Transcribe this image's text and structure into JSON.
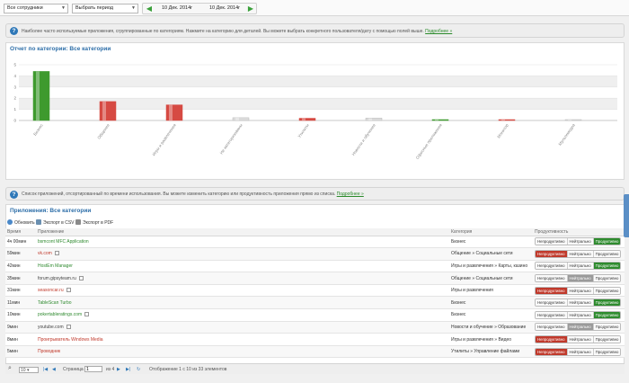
{
  "toolbar": {
    "employee_select": "Все сотрудники",
    "period_select": "Выбрать период",
    "date_from": "10 Дек. 2014г",
    "date_to": "10 Дек. 2014г"
  },
  "info_top": {
    "text": "Наиболее часто используемые приложения, сгруппированные по категориям. Нажмите на категорию для деталей. Вы можете выбрать конкретного пользователя/дату с помощью полей выше.",
    "link": "Подробнее »"
  },
  "chart_panel": {
    "title": "Отчет по категории:  Все категории"
  },
  "chart_data": {
    "type": "bar",
    "title": "",
    "xlabel": "",
    "ylabel": "",
    "ylim": [
      0,
      5
    ],
    "yticks": [
      "0",
      "1",
      "2",
      "3",
      "4",
      "5"
    ],
    "categories": [
      "Бизнес",
      "Общение",
      "Игры и развлечения",
      "Не категоризованы",
      "Утилиты",
      "Новости и обучение",
      "Офисные приложения",
      "Монитор",
      "Мультимедиа"
    ],
    "values": [
      4.4,
      1.7,
      1.4,
      0.25,
      0.2,
      0.22,
      0.08,
      0.05,
      0.03
    ],
    "bar_colors": [
      "#3e9a2e",
      "#d64a43",
      "#d64a43",
      "#dddddd",
      "#d64a43",
      "#dddddd",
      "#3e9a2e",
      "#d64a43",
      "#dddddd"
    ],
    "grid": true
  },
  "info_apps": {
    "text": "Список приложений, отсортированный по времени использования. Вы можете изменить категорию или продуктивность приложения прямо из списка.",
    "link": "Подробнее »"
  },
  "apps_panel": {
    "title": "Приложения: Все категории",
    "refresh": "Обновить",
    "export_csv": "Экспорт в CSV",
    "export_pdf": "Экспорт в PDF"
  },
  "table": {
    "headers": [
      "Время",
      "Приложение",
      "Категория",
      "Продуктивность"
    ],
    "seg_labels": [
      "Непродуктивно",
      "Нейтрально",
      "Продуктивно"
    ],
    "rows": [
      {
        "time": "4ч 00мин",
        "app": "bsmcont MFC Application",
        "cat": "Бизнес",
        "prod": 2,
        "ext": false
      },
      {
        "time": "59мин",
        "app": "vk.com",
        "cat": "Общение » Социальные сети",
        "prod": 0,
        "ext": true
      },
      {
        "time": "42мин",
        "app": "HostEm Manager",
        "cat": "Игры и развлечения » Карты, казино",
        "prod": 2,
        "ext": false
      },
      {
        "time": "35мин",
        "app": "forum.gipsyteam.ru",
        "cat": "Общение » Социальные сети",
        "prod": 1,
        "ext": true
      },
      {
        "time": "31мин",
        "app": "seasoncar.ru",
        "cat": "Игры и развлечения",
        "prod": 0,
        "ext": true
      },
      {
        "time": "11мин",
        "app": "TableScan Turbo",
        "cat": "Бизнес",
        "prod": 2,
        "ext": false
      },
      {
        "time": "10мин",
        "app": "pokertableratings.com",
        "cat": "Бизнес",
        "prod": 2,
        "ext": true
      },
      {
        "time": "9мин",
        "app": "youtube.com",
        "cat": "Новости и обучение » Образование",
        "prod": 1,
        "ext": true
      },
      {
        "time": "8мин",
        "app": "Проигрыватель Windows Media",
        "cat": "Игры и развлечения » Видео",
        "prod": 0,
        "ext": false
      },
      {
        "time": "5мин",
        "app": "Проводник",
        "cat": "Утилиты » Управление файлами",
        "prod": 0,
        "ext": false
      }
    ]
  },
  "pager": {
    "page_size": "10",
    "page_label": "Страница",
    "page_value": "1",
    "of_label": "из 4",
    "summary": "Отображение 1 с 10 из 33 элементов"
  },
  "colors": {
    "accent": "#2d6ea8",
    "productive": "#2e8b2e",
    "unproductive": "#c0392b",
    "neutral": "#9a9a9a"
  }
}
